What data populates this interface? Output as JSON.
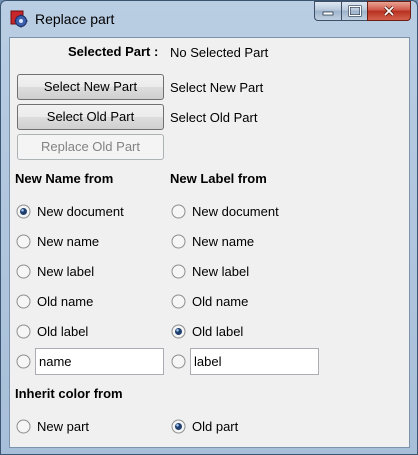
{
  "window": {
    "title": "Replace part",
    "app_icon": "freecad-gear-icon",
    "accent": "#3c5572",
    "close_color": "#c0392b"
  },
  "selection": {
    "selected_part_label": "Selected Part :",
    "selected_part_value": "No Selected Part",
    "select_new_button": "Select New Part",
    "select_new_value": "Select New Part",
    "select_old_button": "Select Old Part",
    "select_old_value": "Select Old Part",
    "replace_button": "Replace Old Part"
  },
  "new_name_from": {
    "heading": "New Name from",
    "options": [
      "New document",
      "New name",
      "New label",
      "Old name",
      "Old label"
    ],
    "selected_index": 0,
    "custom_value": "name"
  },
  "new_label_from": {
    "heading": "New Label from",
    "options": [
      "New document",
      "New name",
      "New label",
      "Old name",
      "Old label"
    ],
    "selected_index": 4,
    "custom_value": "label"
  },
  "inherit_color_from": {
    "heading": "Inherit color from",
    "options": [
      "New part",
      "Old part"
    ],
    "selected_index": 1
  }
}
